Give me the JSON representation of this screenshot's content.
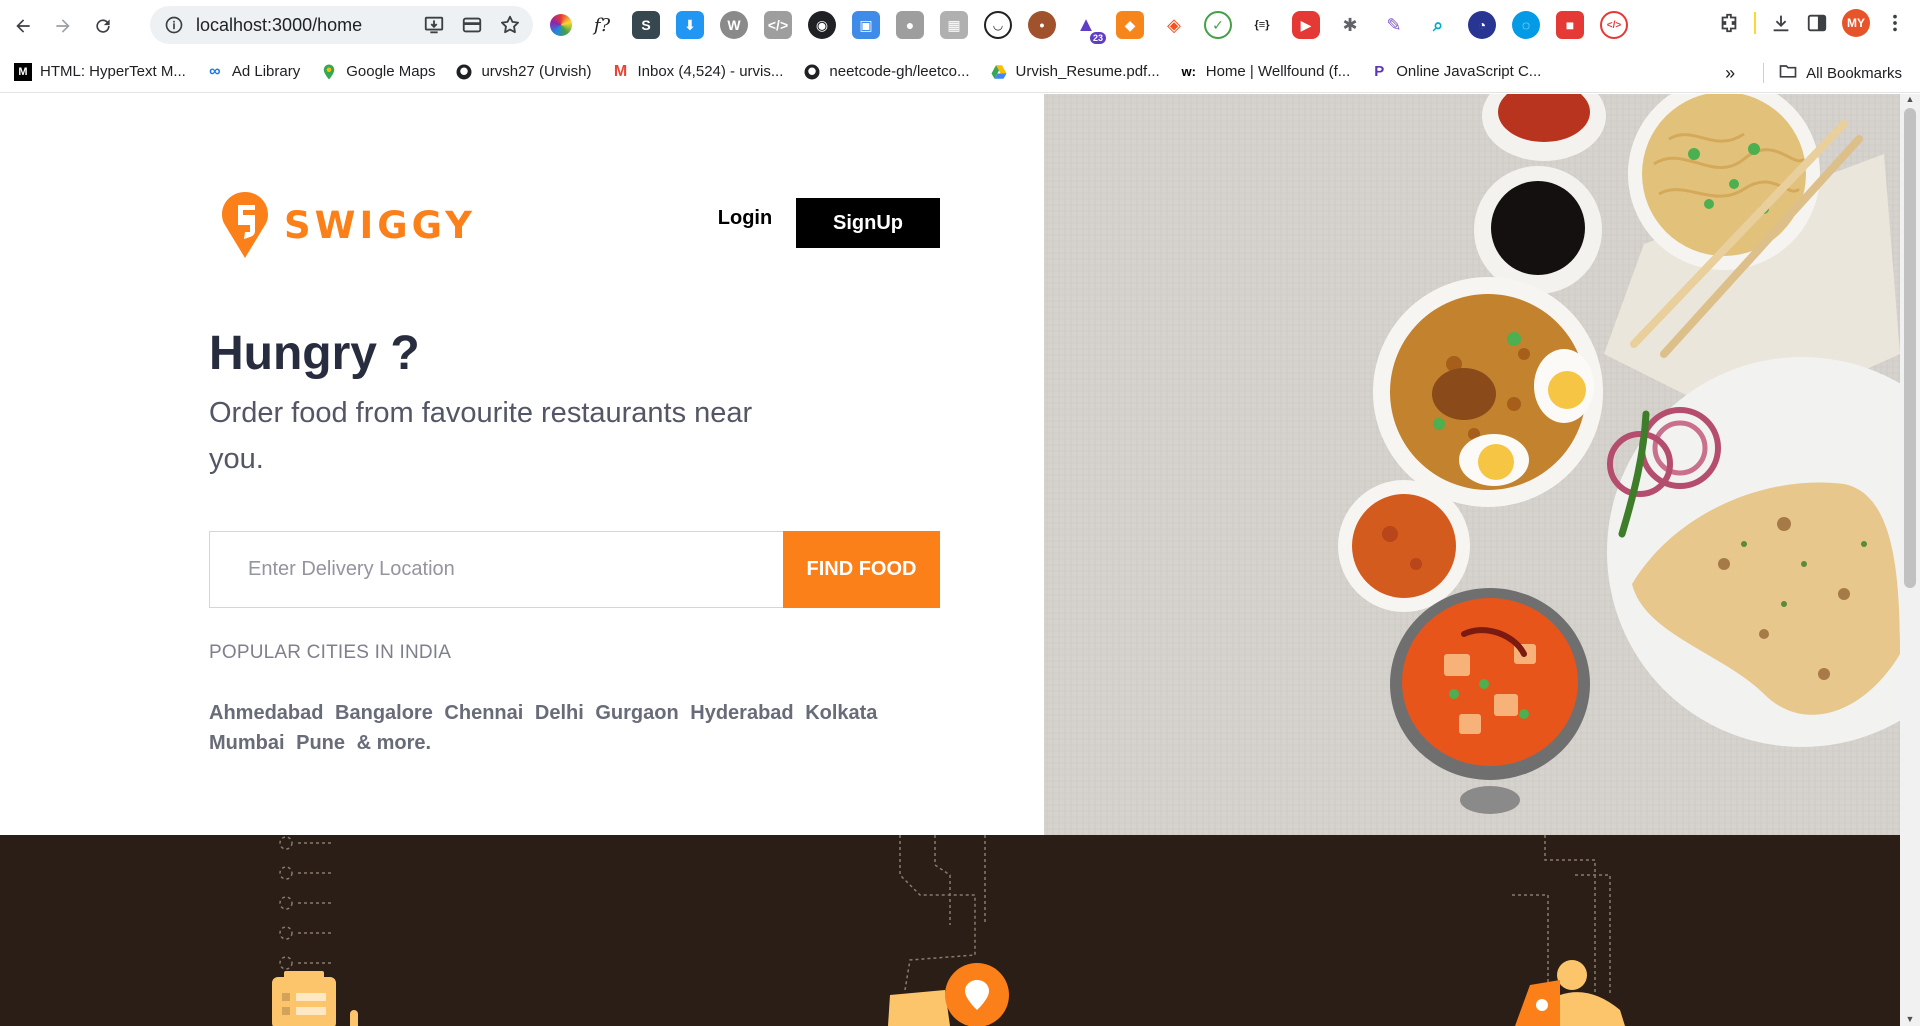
{
  "browser": {
    "url": "localhost:3000/home",
    "avatar_initials": "MY",
    "extension_badge": "23",
    "bookmarks": [
      {
        "label": "HTML: HyperText M...",
        "icon": "mdn-icon"
      },
      {
        "label": "Ad Library",
        "icon": "meta-icon"
      },
      {
        "label": "Google Maps",
        "icon": "maps-pin-icon"
      },
      {
        "label": "urvsh27 (Urvish)",
        "icon": "github-icon"
      },
      {
        "label": "Inbox (4,524) - urvis...",
        "icon": "gmail-icon"
      },
      {
        "label": "neetcode-gh/leetco...",
        "icon": "github-icon"
      },
      {
        "label": "Urvish_Resume.pdf...",
        "icon": "drive-icon"
      },
      {
        "label": "Home | Wellfound (f...",
        "icon": "wellfound-icon"
      },
      {
        "label": "Online JavaScript C...",
        "icon": "playcode-icon"
      }
    ],
    "all_bookmarks_label": "All Bookmarks"
  },
  "header": {
    "brand": "SWIGGY",
    "login_label": "Login",
    "signup_label": "SignUp"
  },
  "hero": {
    "title": "Hungry ?",
    "subtitle": "Order food from favourite restaurants near you."
  },
  "search": {
    "placeholder": "Enter Delivery Location",
    "button_label": "FIND FOOD"
  },
  "popular": {
    "heading": "POPULAR CITIES IN INDIA",
    "cities": [
      "Ahmedabad",
      "Bangalore",
      "Chennai",
      "Delhi",
      "Gurgaon",
      "Hyderabad",
      "Kolkata",
      "Mumbai",
      "Pune"
    ],
    "more_label": "& more."
  },
  "colors": {
    "brand_orange": "#fc8019",
    "dark_band": "#2b1e16",
    "text_dark": "#282c3f"
  }
}
